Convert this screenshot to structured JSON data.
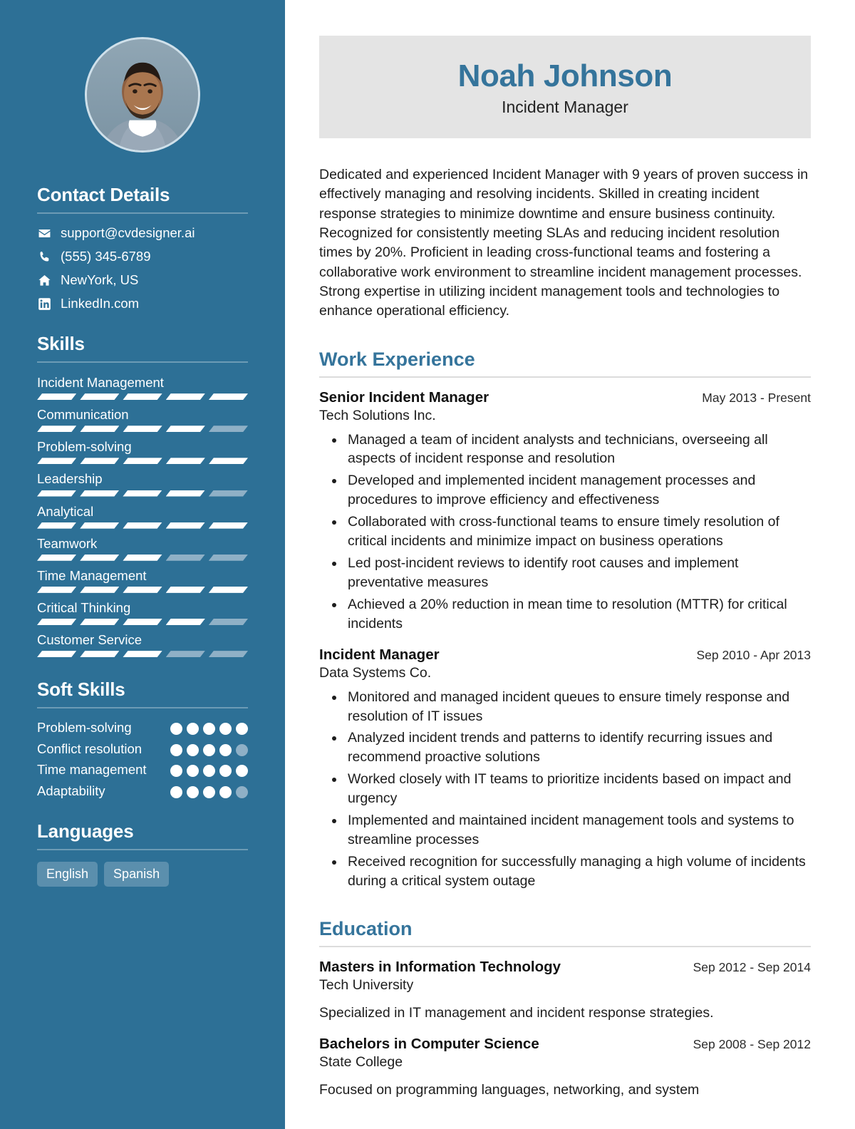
{
  "theme": {
    "sidebar_bg": "#2d7096",
    "accent": "#35749b",
    "header_band_bg": "#e4e4e4",
    "bar_empty": "#8fb0c6",
    "bar_full": "#ffffff"
  },
  "header": {
    "name": "Noah Johnson",
    "job_title": "Incident Manager"
  },
  "summary": {
    "text": "Dedicated and experienced Incident Manager with 9 years of proven success in effectively managing and resolving incidents. Skilled in creating incident response strategies to minimize downtime and ensure business continuity. Recognized for consistently meeting SLAs and reducing incident resolution times by 20%. Proficient in leading cross-functional teams and fostering a collaborative work environment to streamline incident management processes. Strong expertise in utilizing incident management tools and technologies to enhance operational efficiency."
  },
  "sidebar": {
    "contact": {
      "heading": "Contact Details",
      "items": [
        {
          "icon": "envelope-icon",
          "value": "support@cvdesigner.ai"
        },
        {
          "icon": "phone-icon",
          "value": "(555) 345-6789"
        },
        {
          "icon": "home-icon",
          "value": "NewYork, US"
        },
        {
          "icon": "linkedin-icon",
          "value": "LinkedIn.com"
        }
      ]
    },
    "skills": {
      "heading": "Skills",
      "max": 5,
      "items": [
        {
          "label": "Incident Management",
          "level": 5
        },
        {
          "label": "Communication",
          "level": 4
        },
        {
          "label": "Problem-solving",
          "level": 5
        },
        {
          "label": "Leadership",
          "level": 4
        },
        {
          "label": "Analytical",
          "level": 5
        },
        {
          "label": "Teamwork",
          "level": 3
        },
        {
          "label": "Time Management",
          "level": 5
        },
        {
          "label": "Critical Thinking",
          "level": 4
        },
        {
          "label": "Customer Service",
          "level": 3
        }
      ]
    },
    "soft_skills": {
      "heading": "Soft Skills",
      "max": 5,
      "items": [
        {
          "label": "Problem-solving",
          "level": 5
        },
        {
          "label": "Conflict resolution",
          "level": 4
        },
        {
          "label": "Time management",
          "level": 5
        },
        {
          "label": "Adaptability",
          "level": 4
        }
      ]
    },
    "languages": {
      "heading": "Languages",
      "items": [
        "English",
        "Spanish"
      ]
    }
  },
  "work_experience": {
    "heading": "Work Experience",
    "entries": [
      {
        "title": "Senior Incident Manager",
        "organization": "Tech Solutions Inc.",
        "date": "May 2013 - Present",
        "bullets": [
          "Managed a team of incident analysts and technicians, overseeing all aspects of incident response and resolution",
          "Developed and implemented incident management processes and procedures to improve efficiency and effectiveness",
          "Collaborated with cross-functional teams to ensure timely resolution of critical incidents and minimize impact on business operations",
          "Led post-incident reviews to identify root causes and implement preventative measures",
          "Achieved a 20% reduction in mean time to resolution (MTTR) for critical incidents"
        ]
      },
      {
        "title": "Incident Manager",
        "organization": "Data Systems Co.",
        "date": "Sep 2010 - Apr 2013",
        "bullets": [
          "Monitored and managed incident queues to ensure timely response and resolution of IT issues",
          "Analyzed incident trends and patterns to identify recurring issues and recommend proactive solutions",
          "Worked closely with IT teams to prioritize incidents based on impact and urgency",
          "Implemented and maintained incident management tools and systems to streamline processes",
          "Received recognition for successfully managing a high volume of incidents during a critical system outage"
        ]
      }
    ]
  },
  "education": {
    "heading": "Education",
    "entries": [
      {
        "title": "Masters in Information Technology",
        "organization": "Tech University",
        "date": "Sep 2012 - Sep 2014",
        "note": "Specialized in IT management and incident response strategies."
      },
      {
        "title": "Bachelors in Computer Science",
        "organization": "State College",
        "date": "Sep 2008 - Sep 2012",
        "note": "Focused on programming languages, networking, and system"
      }
    ]
  }
}
